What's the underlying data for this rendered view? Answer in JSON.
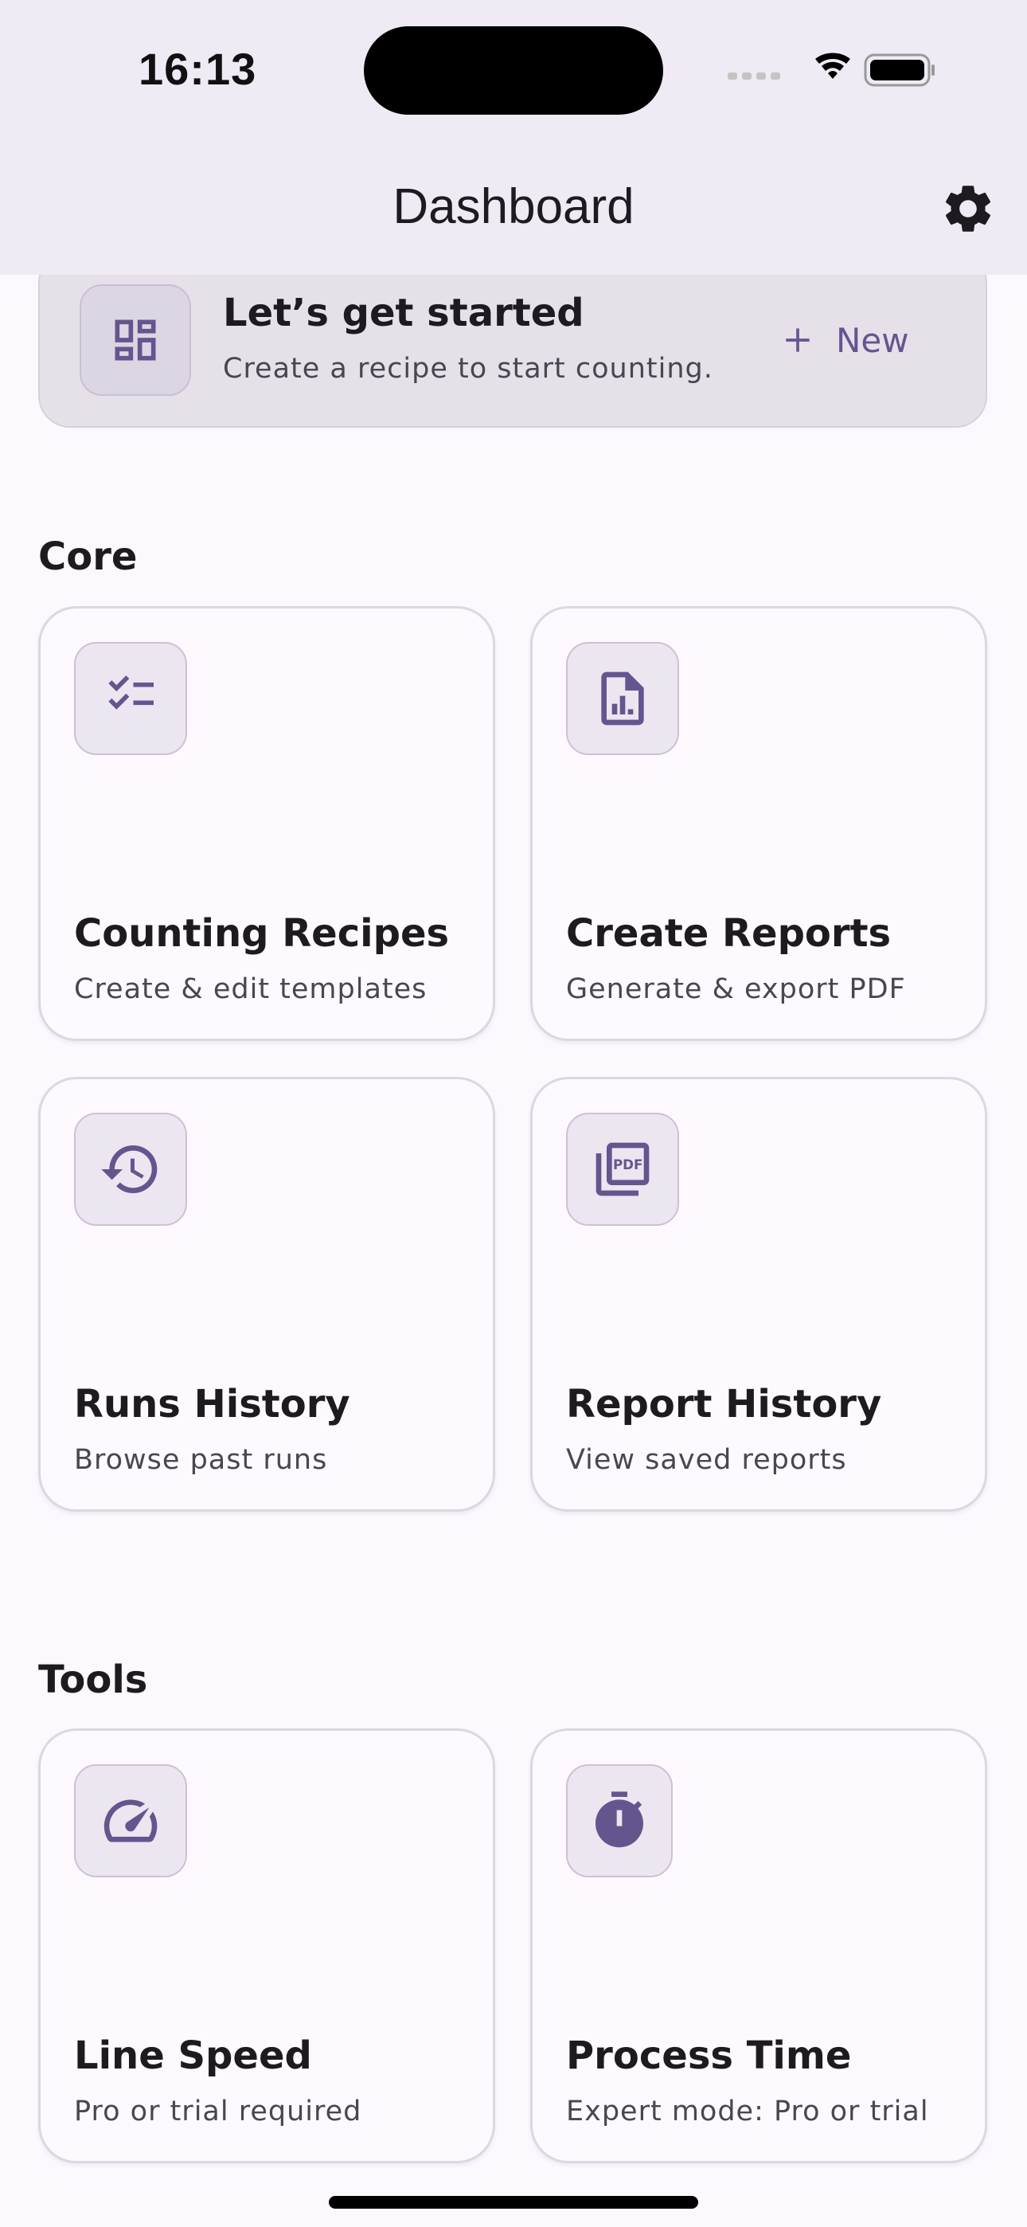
{
  "status_bar": {
    "time": "16:13",
    "icons": [
      "signal-icon",
      "wifi-icon",
      "battery-icon"
    ]
  },
  "app_bar": {
    "title": "Dashboard",
    "settings_icon": "gear-icon"
  },
  "banner": {
    "icon": "dashboard-icon",
    "title": "Let’s get started",
    "subtitle": "Create a recipe to start counting.",
    "action_label": "New"
  },
  "sections": {
    "core": {
      "title": "Core",
      "cards": [
        {
          "icon": "checklist-icon",
          "title": "Counting Recipes",
          "subtitle": "Create & edit templates"
        },
        {
          "icon": "report-chart-icon",
          "title": "Create Reports",
          "subtitle": "Generate & export PDF"
        },
        {
          "icon": "history-icon",
          "title": "Runs History",
          "subtitle": "Browse past runs"
        },
        {
          "icon": "pdf-stack-icon",
          "title": "Report History",
          "subtitle": "View saved reports"
        }
      ]
    },
    "tools": {
      "title": "Tools",
      "cards": [
        {
          "icon": "speedometer-icon",
          "title": "Line Speed",
          "subtitle": "Pro or trial required"
        },
        {
          "icon": "timer-icon",
          "title": "Process Time",
          "subtitle": "Expert mode: Pro or trial"
        }
      ]
    }
  },
  "colors": {
    "accent": "#65558F",
    "background": "#FCF8FD",
    "app_bar": "#F0EAF4",
    "banner": "#E6E0E9",
    "icon_tile": "#ECE6F0"
  }
}
